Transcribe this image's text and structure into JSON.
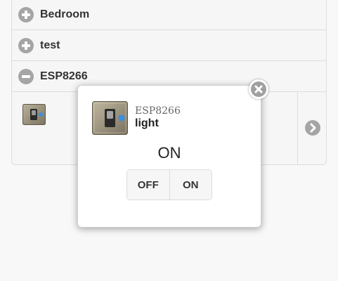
{
  "accordion": {
    "sections": [
      {
        "label": "Bedroom",
        "icon": "plus-icon",
        "expanded": false
      },
      {
        "label": "test",
        "icon": "plus-icon",
        "expanded": false
      },
      {
        "label": "ESP8266",
        "icon": "minus-icon",
        "expanded": true
      }
    ],
    "next_icon": "chevron-right-icon"
  },
  "popup": {
    "device_name": "ESP8266",
    "device_type": "light",
    "state": "ON",
    "buttons": {
      "off_label": "OFF",
      "on_label": "ON"
    },
    "close_icon": "close-icon",
    "device_icon": "light-switch-icon"
  },
  "colors": {
    "icon_gray": "#a5a5a5",
    "background": "#f8f8f8",
    "accent_blue": "#3a8fe0"
  }
}
